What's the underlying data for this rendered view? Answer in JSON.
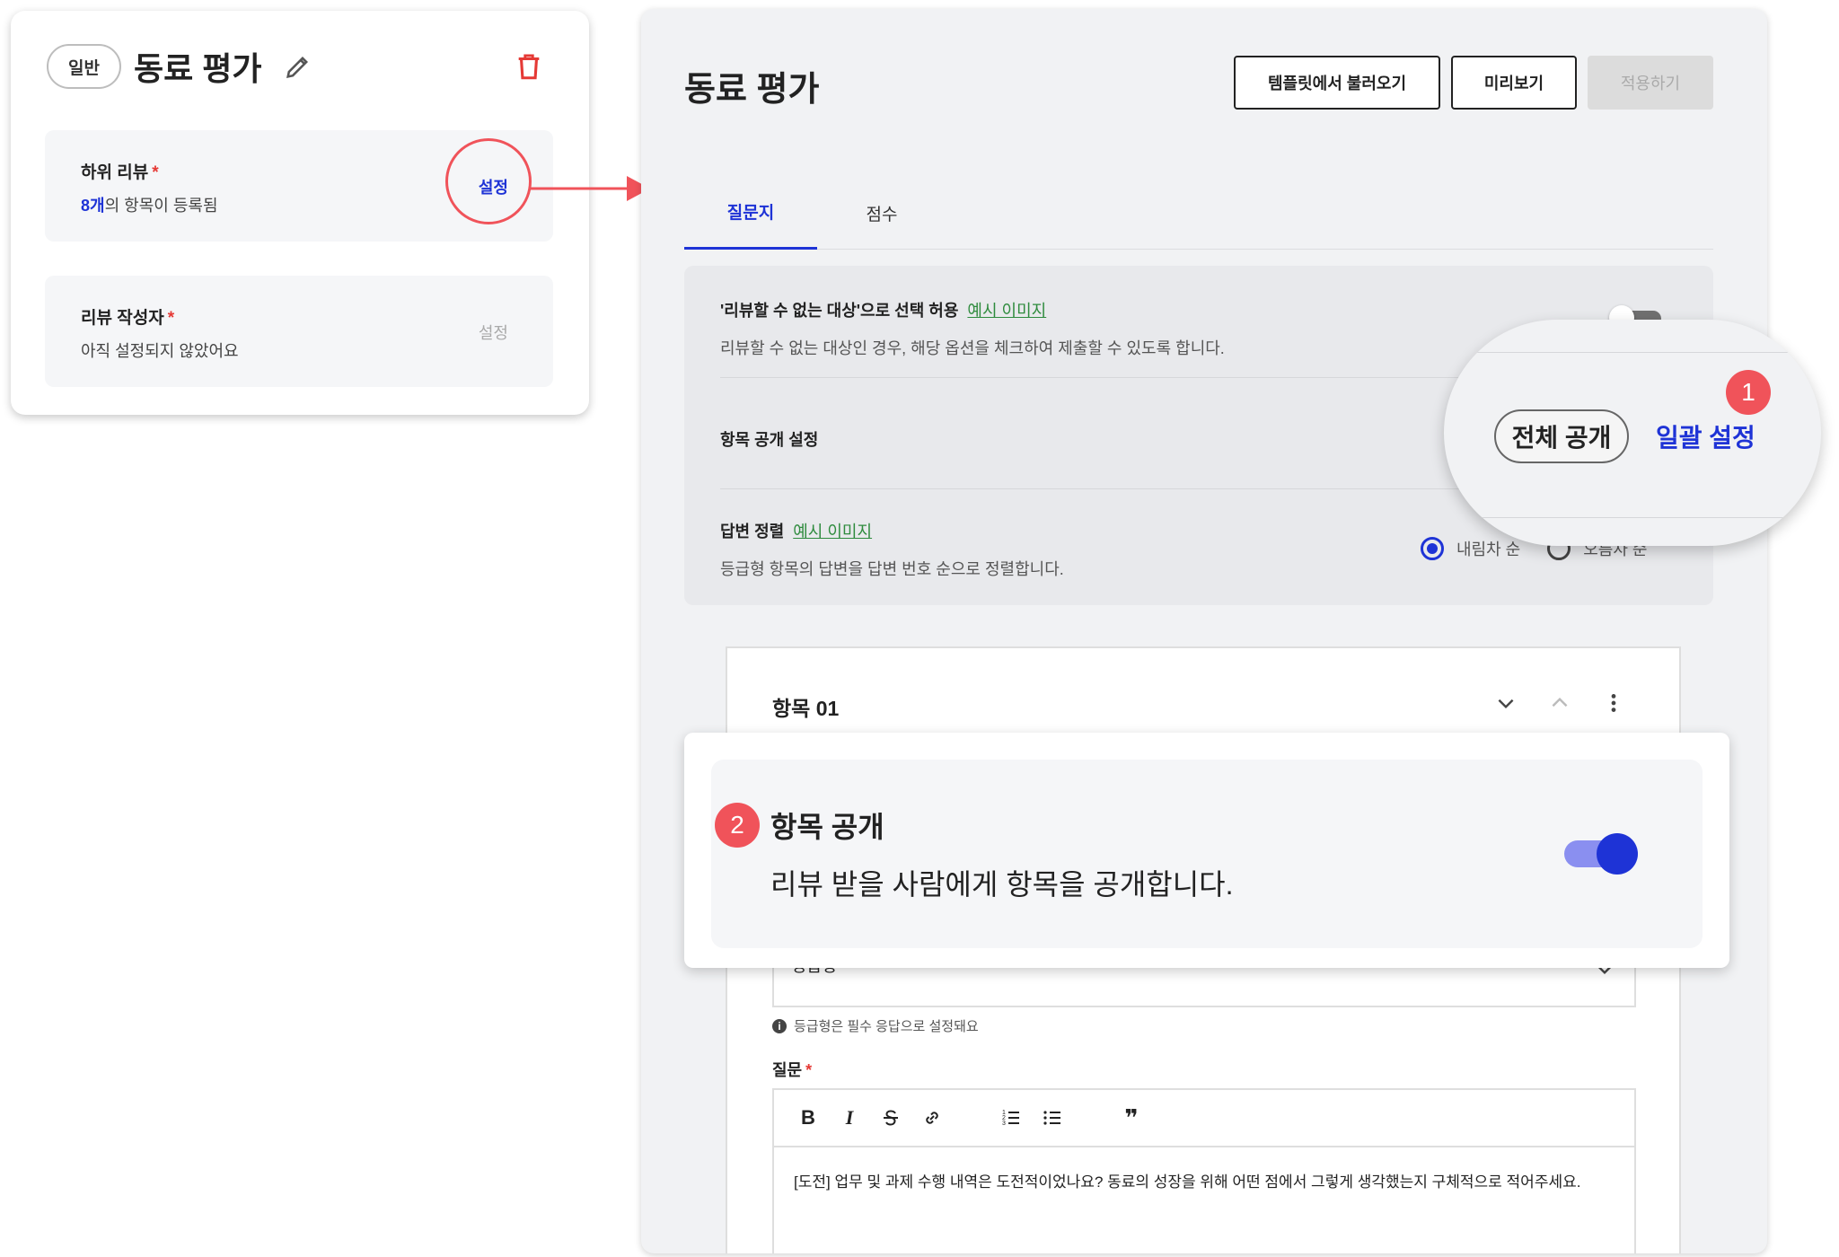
{
  "left_card": {
    "chip": "일반",
    "title": "동료 평가",
    "items": [
      {
        "label": "하위 리뷰",
        "required": "*",
        "count": "8개",
        "sub_rest": "의 항목이 등록됨",
        "action": "설정"
      },
      {
        "label": "리뷰 작성자",
        "required": "*",
        "sub": "아직 설정되지 않았어요",
        "action": "설정"
      }
    ]
  },
  "panel": {
    "title": "동료 평가",
    "buttons": {
      "template": "템플릿에서 불러오기",
      "preview": "미리보기",
      "apply": "적용하기"
    },
    "tabs": [
      {
        "label": "질문지"
      },
      {
        "label": "점수"
      }
    ],
    "settings": {
      "unreviewable": {
        "title": "'리뷰할 수 없는 대상'으로 선택 허용",
        "link": "예시 이미지",
        "desc": "리뷰할 수 없는 대상인 경우, 해당 옵션을 체크하여 제출할 수 있도록 합니다."
      },
      "visibility": {
        "title": "항목 공개 설정"
      },
      "sort": {
        "title": "답변 정렬",
        "link": "예시 이미지",
        "desc": "등급형 항목의 답변을 답변 번호 순으로 정렬합니다.",
        "option_desc": "내림차 순",
        "option_asc": "오름차 순"
      }
    },
    "item": {
      "title": "항목 01",
      "type_select": "등급형",
      "hint": "등급형은 필수 응답으로 설정돼요",
      "question_label": "질문",
      "required": "*",
      "question_text": "[도전] 업무 및 과제 수행 내역은 도전적이었나요? 동료의 성장을 위해 어떤 점에서 그렇게 생각했는지 구체적으로 적어주세요."
    }
  },
  "callout_1": {
    "badge": "1",
    "chip": "전체 공개",
    "action": "일괄 설정"
  },
  "callout_2": {
    "badge": "2",
    "title": "항목 공개",
    "desc": "리뷰 받을 사람에게 항목을 공개합니다.",
    "toggle_on": true
  },
  "toolbar": {
    "bold": "B",
    "italic": "I",
    "quote": "❞"
  },
  "colors": {
    "accent": "#1e33d6",
    "highlight": "#f0535a",
    "link": "#2e8b3d",
    "danger": "#e53935"
  },
  "icons": [
    "pencil-icon",
    "trash-icon",
    "arrow-right-icon",
    "chevron-down-icon",
    "chevron-up-icon",
    "more-vertical-icon",
    "info-icon",
    "strikethrough-icon",
    "link-icon",
    "ordered-list-icon",
    "bullet-list-icon",
    "quote-icon"
  ]
}
